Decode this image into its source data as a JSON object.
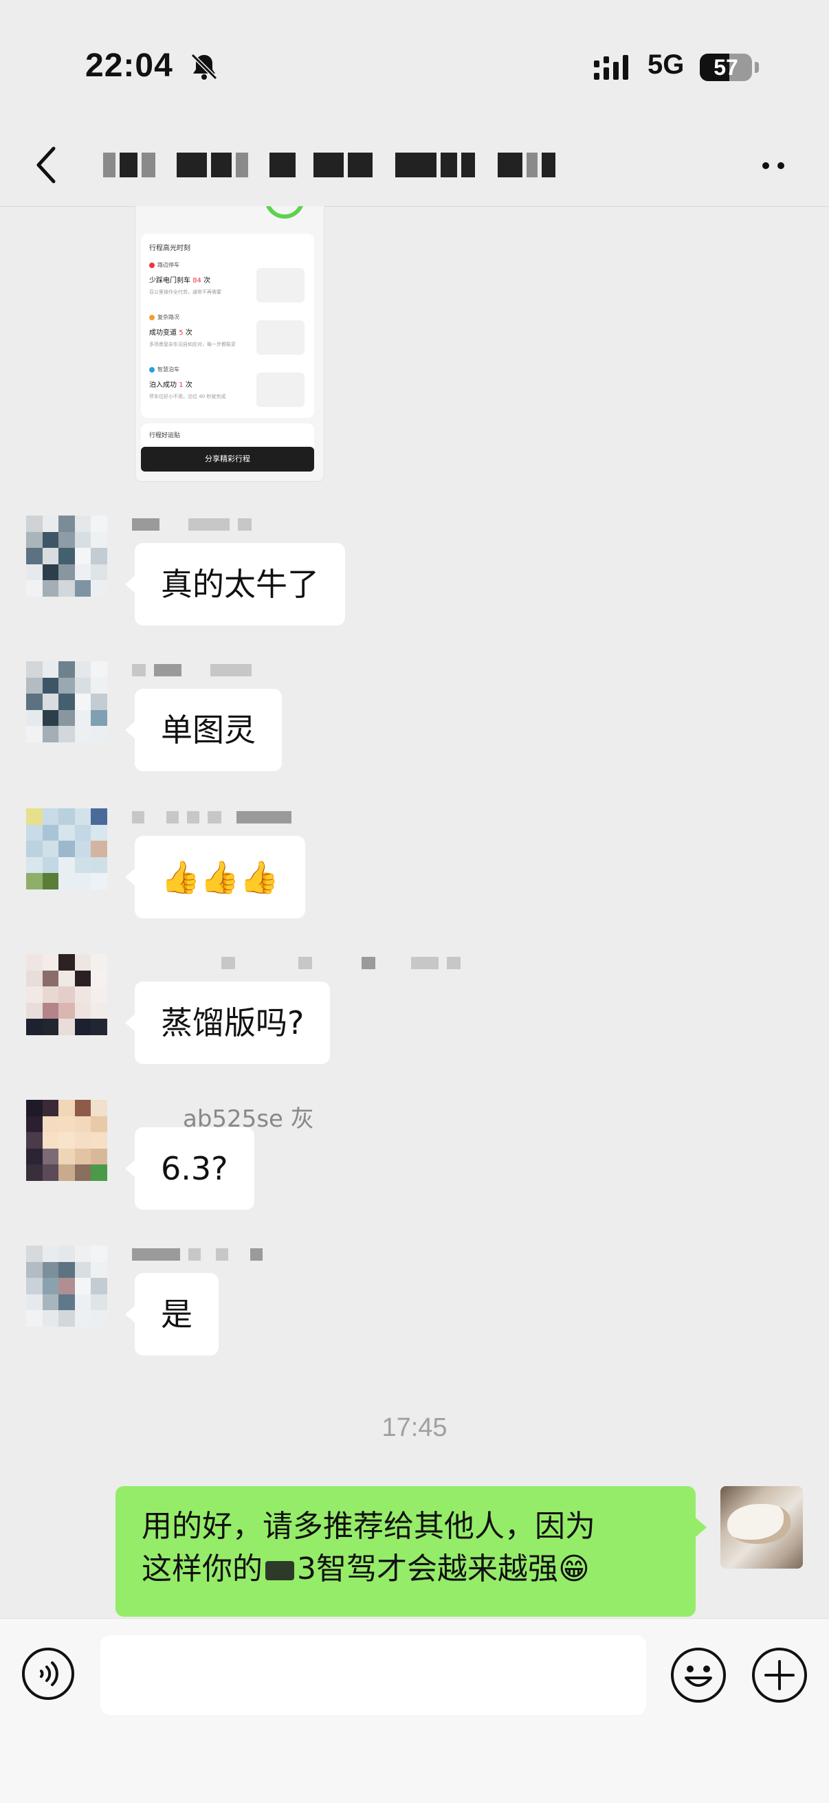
{
  "status_bar": {
    "time": "22:04",
    "network": "5G",
    "battery": "57",
    "battery_level": 0.57
  },
  "nav": {
    "title": "",
    "back_icon": "chevron-left-icon",
    "more_icon": "more-dots-icon"
  },
  "shared_card": {
    "section_title": "行程高光时刻",
    "items": [
      {
        "tag": "路边停车",
        "text": "少踩电门刹车",
        "value": "84",
        "unit": "次",
        "sub": "百公里操作全代劳，通常不再需要"
      },
      {
        "tag": "复杂路况",
        "text": "成功变道",
        "value": "5",
        "unit": "次",
        "sub": "多场景复杂车况自如应对，每一步都稳妥"
      },
      {
        "tag": "智慧泊车",
        "text": "泊入成功",
        "value": "1",
        "unit": "次",
        "sub": "停车位好小不用，泊位 40 秒就完成"
      }
    ],
    "second_section_title": "行程好运贴",
    "share_button": "分享精彩行程"
  },
  "messages": [
    {
      "text": "真的太牛了"
    },
    {
      "text": "单图灵"
    },
    {
      "text": "👍👍👍"
    },
    {
      "text": "蒸馏版吗?"
    },
    {
      "text": "6.3?",
      "sender": "ab525se 灰"
    },
    {
      "text": "是"
    }
  ],
  "timestamp": "17:45",
  "my_message": {
    "line1": "用的好，请多推荐给其他人，因为",
    "line2": "这样你的",
    "line2_b": "3智驾才会越来越强😁"
  },
  "input_bar": {
    "voice_icon": "voice-icon",
    "emoji_icon": "emoji-icon",
    "plus_icon": "plus-icon"
  },
  "colors": {
    "background": "#ededed",
    "my_bubble": "#95ec69",
    "their_bubble": "#ffffff"
  }
}
